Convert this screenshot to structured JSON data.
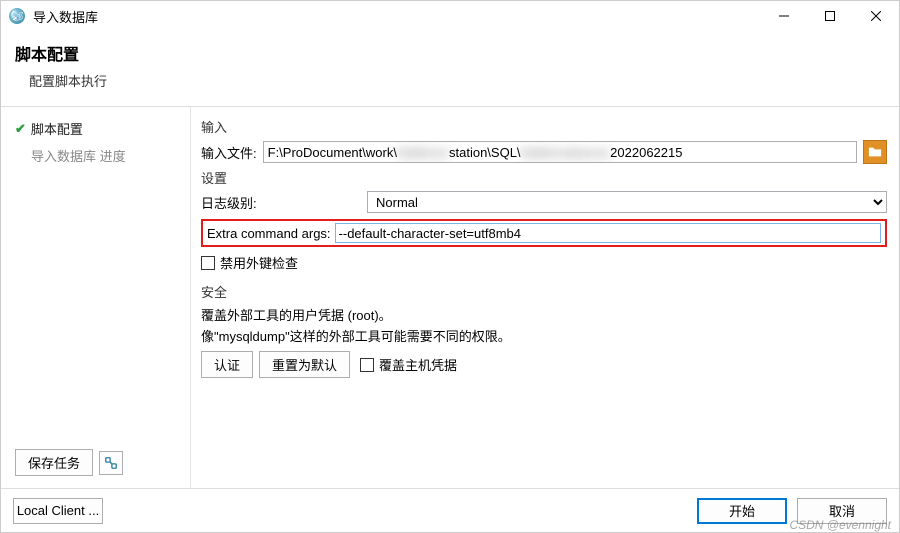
{
  "window": {
    "title": "导入数据库"
  },
  "header": {
    "title": "脚本配置",
    "subtitle": "配置脚本执行"
  },
  "sidebar": {
    "items": [
      {
        "label": "脚本配置",
        "active": true
      },
      {
        "label": "导入数据库 进度",
        "active": false
      }
    ],
    "save_task": "保存任务"
  },
  "input_section": {
    "group": "输入",
    "file_label": "输入文件:",
    "file_value_a": "F:\\ProDocument\\work\\",
    "file_value_b": "station\\SQL\\",
    "file_value_c": "2022062215"
  },
  "settings_section": {
    "group": "设置",
    "loglevel_label": "日志级别:",
    "loglevel_value": "Normal",
    "extra_args_label": "Extra command args:",
    "extra_args_value": "--default-character-set=utf8mb4",
    "disable_fk_label": "禁用外键检查"
  },
  "security_section": {
    "group": "安全",
    "line1": "覆盖外部工具的用户凭据 (root)。",
    "line2": "像\"mysqldump\"这样的外部工具可能需要不同的权限。",
    "auth_btn": "认证",
    "reset_btn": "重置为默认",
    "override_host_label": "覆盖主机凭据"
  },
  "footer": {
    "local_client": "Local Client ...",
    "start": "开始",
    "cancel": "取消"
  },
  "watermark": "CSDN @evennight"
}
